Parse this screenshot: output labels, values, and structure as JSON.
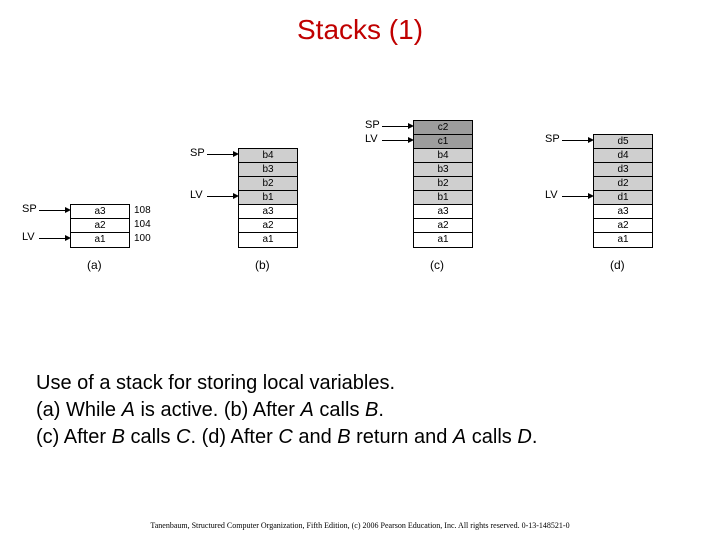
{
  "title": "Stacks (1)",
  "pointer_labels": {
    "sp": "SP",
    "lv": "LV"
  },
  "panels": {
    "a": {
      "label": "(a)",
      "cells": [
        {
          "text": "a3",
          "shade": ""
        },
        {
          "text": "a2",
          "shade": ""
        },
        {
          "text": "a1",
          "shade": ""
        }
      ],
      "addresses": [
        "108",
        "104",
        "100"
      ],
      "sp_row": 0,
      "lv_row": 2
    },
    "b": {
      "label": "(b)",
      "cells": [
        {
          "text": "b4",
          "shade": "mid"
        },
        {
          "text": "b3",
          "shade": "mid"
        },
        {
          "text": "b2",
          "shade": "mid"
        },
        {
          "text": "b1",
          "shade": "mid"
        },
        {
          "text": "a3",
          "shade": ""
        },
        {
          "text": "a2",
          "shade": ""
        },
        {
          "text": "a1",
          "shade": ""
        }
      ],
      "sp_row": 0,
      "lv_row": 3
    },
    "c": {
      "label": "(c)",
      "cells": [
        {
          "text": "c2",
          "shade": "dark"
        },
        {
          "text": "c1",
          "shade": "dark"
        },
        {
          "text": "b4",
          "shade": "mid"
        },
        {
          "text": "b3",
          "shade": "mid"
        },
        {
          "text": "b2",
          "shade": "mid"
        },
        {
          "text": "b1",
          "shade": "mid"
        },
        {
          "text": "a3",
          "shade": ""
        },
        {
          "text": "a2",
          "shade": ""
        },
        {
          "text": "a1",
          "shade": ""
        }
      ],
      "sp_row": 0,
      "lv_row": 1
    },
    "d": {
      "label": "(d)",
      "cells": [
        {
          "text": "d5",
          "shade": "mid"
        },
        {
          "text": "d4",
          "shade": "mid"
        },
        {
          "text": "d3",
          "shade": "mid"
        },
        {
          "text": "d2",
          "shade": "mid"
        },
        {
          "text": "d1",
          "shade": "mid"
        },
        {
          "text": "a3",
          "shade": ""
        },
        {
          "text": "a2",
          "shade": ""
        },
        {
          "text": "a1",
          "shade": ""
        }
      ],
      "sp_row": 0,
      "lv_row": 4
    }
  },
  "caption": {
    "line1": "Use of a stack for storing local variables.",
    "line2_a": " (a) While ",
    "line2_A": "A",
    "line2_b": " is active. (b) After ",
    "line2_B": "A",
    "line2_c": " calls ",
    "line2_C": "B",
    "line2_d": ".",
    "line3_a": " (c) After ",
    "line3_B": "B",
    "line3_b": " calls ",
    "line3_C": "C",
    "line3_c": ".    (d) After ",
    "line3_D": "C",
    "line3_d": " and ",
    "line3_E": "B",
    "line3_e": " return and ",
    "line3_F": "A",
    "line3_f": " calls ",
    "line3_G": "D",
    "line3_g": "."
  },
  "footer": "Tanenbaum, Structured Computer Organization, Fifth Edition, (c) 2006 Pearson Education, Inc. All rights reserved. 0-13-148521-0"
}
